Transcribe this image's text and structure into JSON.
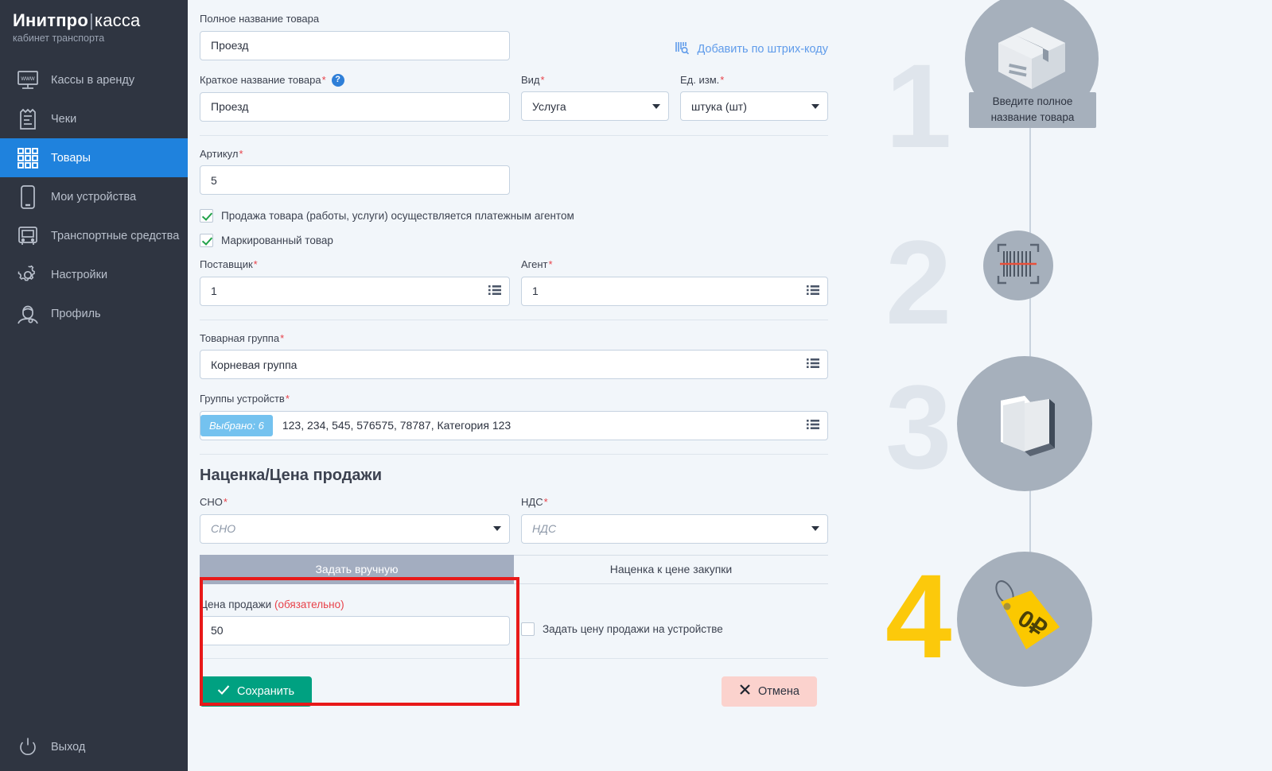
{
  "sidebar": {
    "brand_bold": "Инитпро",
    "brand_sep": "|",
    "brand_light": "касса",
    "brand_sub": "кабинет транспорта",
    "items": [
      {
        "label": "Кассы в аренду",
        "icon": "monitor-www-icon",
        "active": false
      },
      {
        "label": "Чеки",
        "icon": "receipt-icon",
        "active": false
      },
      {
        "label": "Товары",
        "icon": "grid-products-icon",
        "active": true
      },
      {
        "label": "Мои устройства",
        "icon": "smartphone-icon",
        "active": false
      },
      {
        "label": "Транспортные средства",
        "icon": "bus-icon",
        "active": false
      },
      {
        "label": "Настройки",
        "icon": "gear-icon",
        "active": false
      },
      {
        "label": "Профиль",
        "icon": "user-profile-icon",
        "active": false
      }
    ],
    "logout_label": "Выход",
    "logout_icon": "power-icon",
    "active_color": "#1f82dd",
    "bg_color": "#2f3541"
  },
  "form": {
    "full_name": {
      "label": "Полное название товара",
      "value": "Проезд"
    },
    "barcode_link": {
      "label": "Добавить по штрих-коду",
      "icon": "barcode-scan-icon",
      "color": "#5f9bea"
    },
    "short_name": {
      "label": "Краткое название товара",
      "required": "*",
      "help_icon": "question-help-icon",
      "value": "Проезд"
    },
    "kind": {
      "label": "Вид",
      "required": "*",
      "value": "Услуга"
    },
    "unit": {
      "label": "Ед. изм.",
      "required": "*",
      "value": "штука (шт)"
    },
    "article": {
      "label": "Артикул",
      "required": "*",
      "value": "5"
    },
    "checkbox_agent": {
      "label": "Продажа товара (работы, услуги) осуществляется платежным агентом",
      "checked": true
    },
    "checkbox_marked": {
      "label": "Маркированный товар",
      "checked": true
    },
    "supplier": {
      "label": "Поставщик",
      "required": "*",
      "value": "1",
      "icon": "list-select-icon"
    },
    "agent": {
      "label": "Агент",
      "required": "*",
      "value": "1",
      "icon": "list-select-icon"
    },
    "product_group": {
      "label": "Товарная группа",
      "required": "*",
      "value": "Корневая группа",
      "icon": "list-select-icon"
    },
    "device_groups": {
      "label": "Группы устройств",
      "required": "*",
      "tag": "Выбрано: 6",
      "value": "123, 234, 545, 576575, 78787, Категория 123",
      "icon": "list-select-icon"
    },
    "price_section": {
      "title": "Наценка/Цена продажи",
      "sno": {
        "label": "СНО",
        "required": "*",
        "placeholder": "СНО"
      },
      "nds": {
        "label": "НДС",
        "required": "*",
        "placeholder": "НДС"
      },
      "tab_manual": "Задать вручную",
      "tab_markup": "Наценка к цене закупки",
      "selling_price_label": "Цена продажи",
      "selling_price_mandatory": "(обязательно)",
      "selling_price_value": "50",
      "device_price_checkbox": {
        "label": "Задать цену продажи на устройстве",
        "checked": false
      },
      "highlight_color": "#e81919"
    },
    "footer": {
      "save_label": "Сохранить",
      "save_icon": "check-icon",
      "cancel_label": "Отмена",
      "cancel_icon": "close-x-icon"
    }
  },
  "stepper": {
    "steps": [
      {
        "number": "1",
        "icon": "box-package-icon",
        "tooltip_line1": "Введите полное",
        "tooltip_line2": "название товара",
        "gold": false
      },
      {
        "number": "2",
        "icon": "barcode-scan-circle-icon",
        "tooltip_line1": "",
        "tooltip_line2": "",
        "gold": false
      },
      {
        "number": "3",
        "icon": "folder-icon",
        "tooltip_line1": "",
        "tooltip_line2": "",
        "gold": false
      },
      {
        "number": "4",
        "icon": "price-tag-icon",
        "tooltip_line1": "",
        "tooltip_line2": "",
        "gold": true
      }
    ],
    "price_tag_text": "0₽",
    "circle_color": "#a6b0bc",
    "gold_color": "#fcc90b"
  }
}
